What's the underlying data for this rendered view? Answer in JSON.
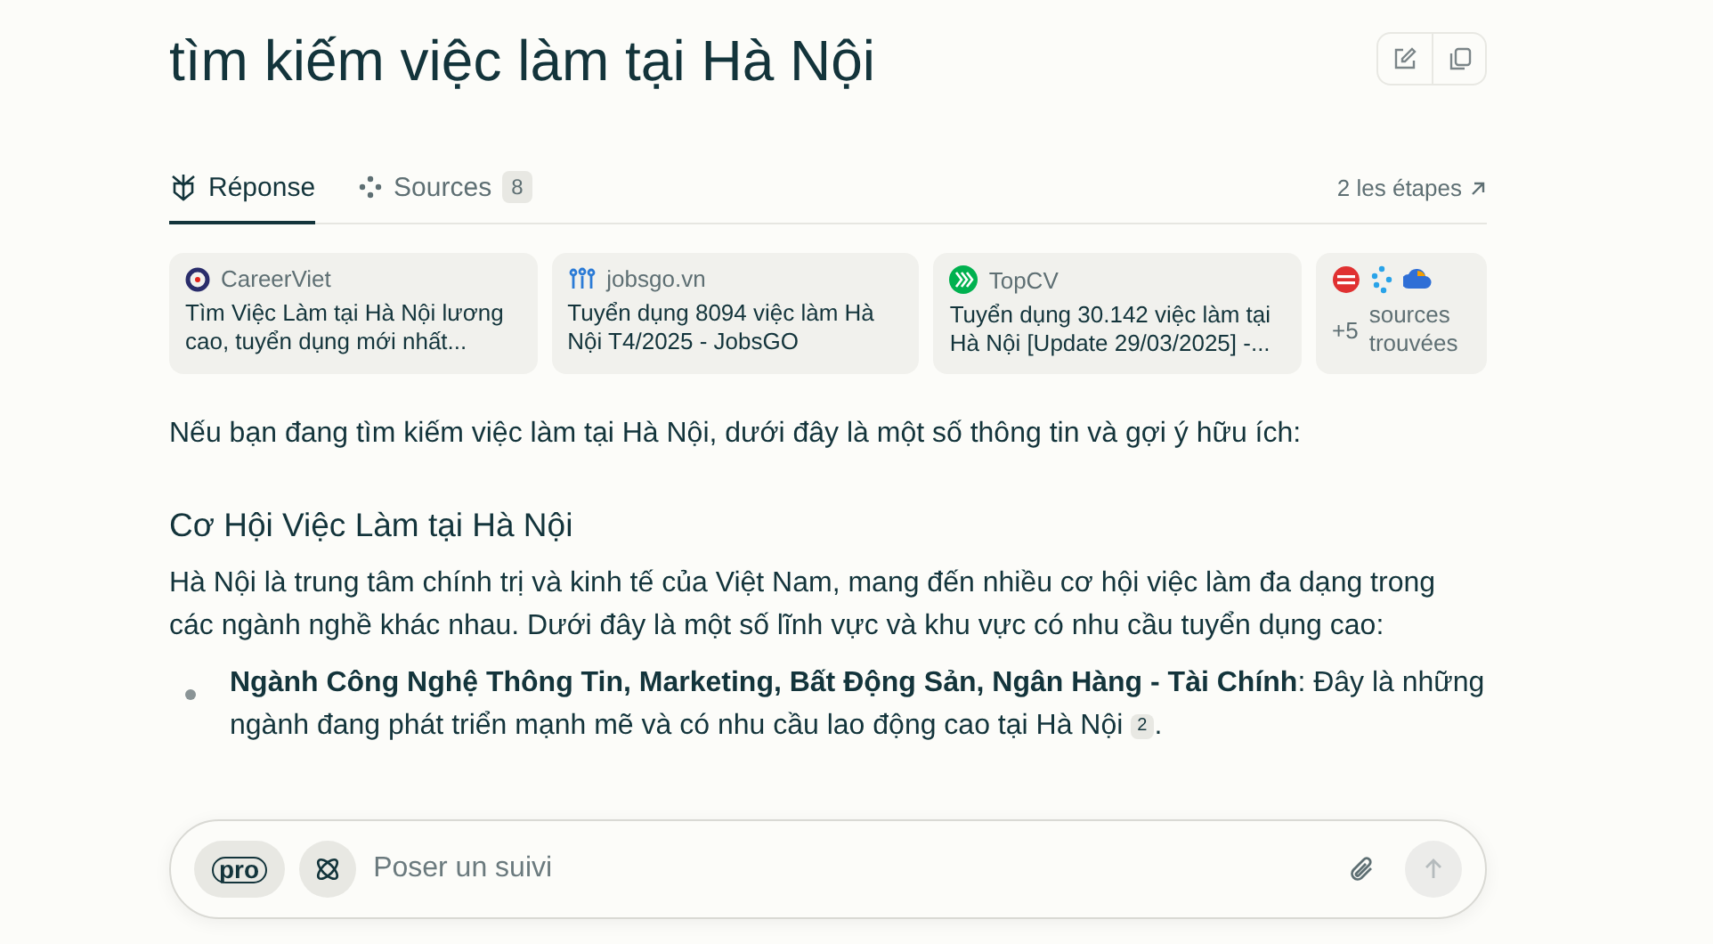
{
  "title": "tìm kiếm việc làm tại Hà Nội",
  "tabs": [
    {
      "label": "Réponse",
      "selected": true
    },
    {
      "label": "Sources",
      "selected": false,
      "count": "8"
    }
  ],
  "steps_link": "2 les étapes",
  "sources": [
    {
      "kind": "source",
      "site": "CareerViet",
      "title": "Tìm Việc Làm tại Hà Nội lương cao, tuyển dụng mới nhất..."
    },
    {
      "kind": "source",
      "site": "jobsgo.vn",
      "title": "Tuyển dụng 8094 việc làm Hà Nội T4/2025 - JobsGO"
    },
    {
      "kind": "source",
      "site": "TopCV",
      "title": "Tuyển dụng 30.142 việc làm tại Hà Nội [Update 29/03/2025] -..."
    },
    {
      "kind": "more",
      "count": "+5",
      "label": "sources trouvées"
    }
  ],
  "intro": "Nếu bạn đang tìm kiếm việc làm tại Hà Nội, dưới đây là một số thông tin và gợi ý hữu ích:",
  "heading": "Cơ Hội Việc Làm tại Hà Nội",
  "paragraph": "Hà Nội là trung tâm chính trị và kinh tế của Việt Nam, mang đến nhiều cơ hội việc làm đa dạng trong các ngành nghề khác nhau. Dưới đây là một số lĩnh vực và khu vực có nhu cầu tuyển dụng cao:",
  "bullets": [
    {
      "text": "**Ngành Công Nghệ Thông Tin, Marketing, Bất Động Sản, Ngân Hàng - Tài Chính**: Đây là những ngành đang phát triển mạnh mẽ và có nhu cầu lao động cao tại Hà Nội",
      "citation": "2",
      "suffix": "."
    }
  ],
  "followup": {
    "placeholder": "Poser un suivi",
    "mode": "pro"
  }
}
